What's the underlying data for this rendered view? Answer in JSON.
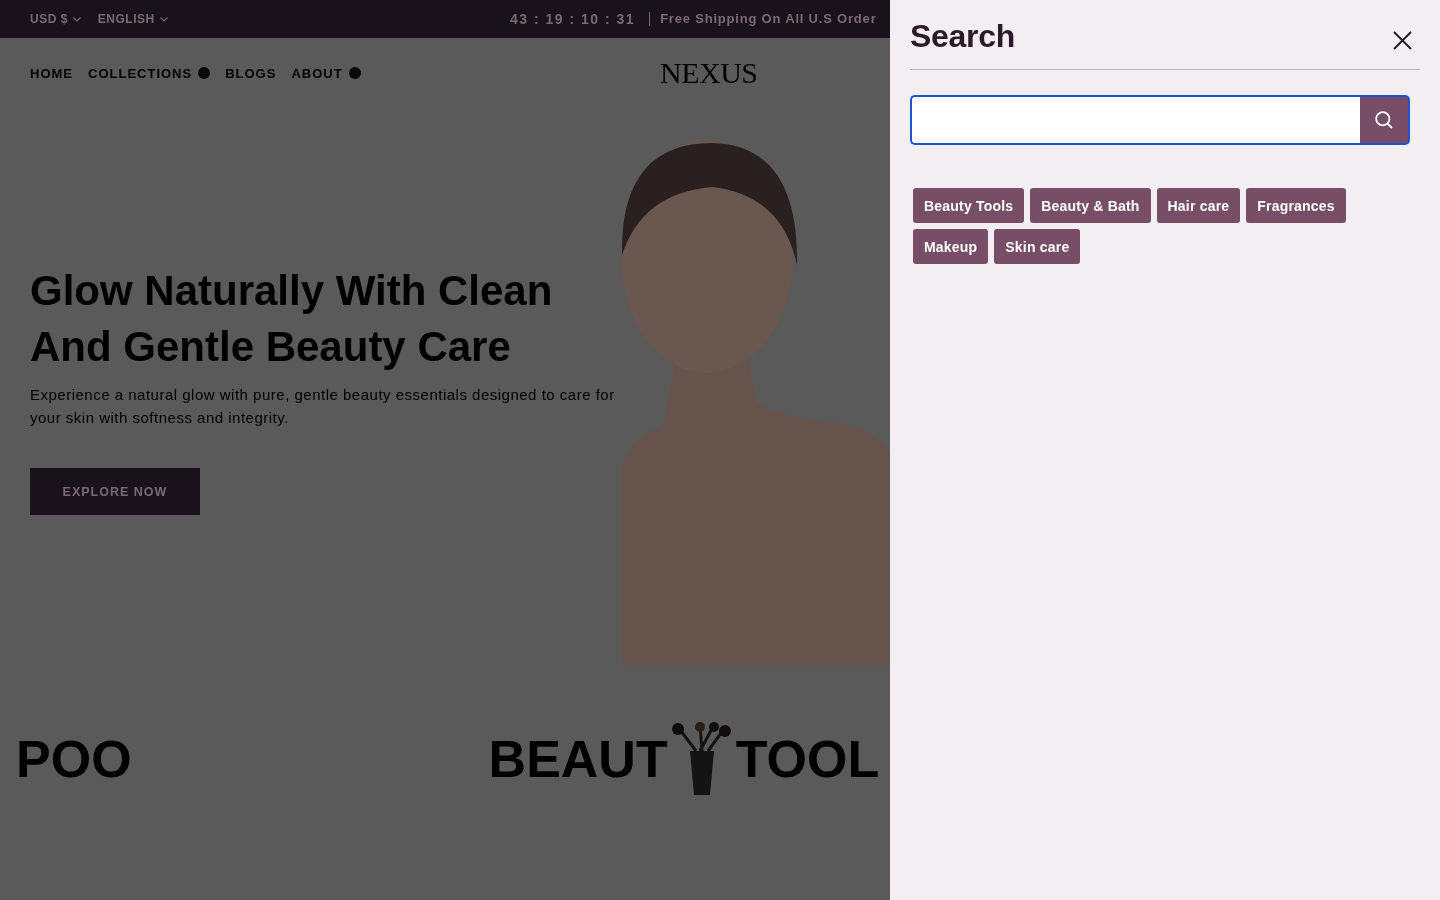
{
  "top_bar": {
    "selectors": [
      {
        "label": "USD $"
      },
      {
        "label": "ENGLISH"
      }
    ],
    "countdown": "43 : 19 : 10 : 31",
    "announcement": "Free Shipping On All U.S Order"
  },
  "header": {
    "nav": [
      {
        "label": "HOME",
        "has_submenu": false
      },
      {
        "label": "COLLECTIONS",
        "has_submenu": true
      },
      {
        "label": "BLOGS",
        "has_submenu": false
      },
      {
        "label": "ABOUT",
        "has_submenu": true
      }
    ],
    "logo": "NEXUS"
  },
  "hero": {
    "heading": "Glow Naturally With Clean And Gentle Beauty Care",
    "text": "Experience a natural glow with pure, gentle beauty essentials designed to care for your skin with softness and integrity.",
    "button": "EXPLORE NOW"
  },
  "marquee": {
    "items": [
      {
        "kind": "text",
        "text": "POO"
      },
      {
        "kind": "text",
        "text": "BEAUT"
      },
      {
        "kind": "image"
      },
      {
        "kind": "text",
        "text": "TOOL"
      }
    ]
  },
  "search_panel": {
    "title": "Search",
    "query": {
      "focused": true
    },
    "tags": [
      "Beauty Tools",
      "Beauty & Bath",
      "Hair care",
      "Fragrances",
      "Makeup",
      "Skin care"
    ]
  }
}
